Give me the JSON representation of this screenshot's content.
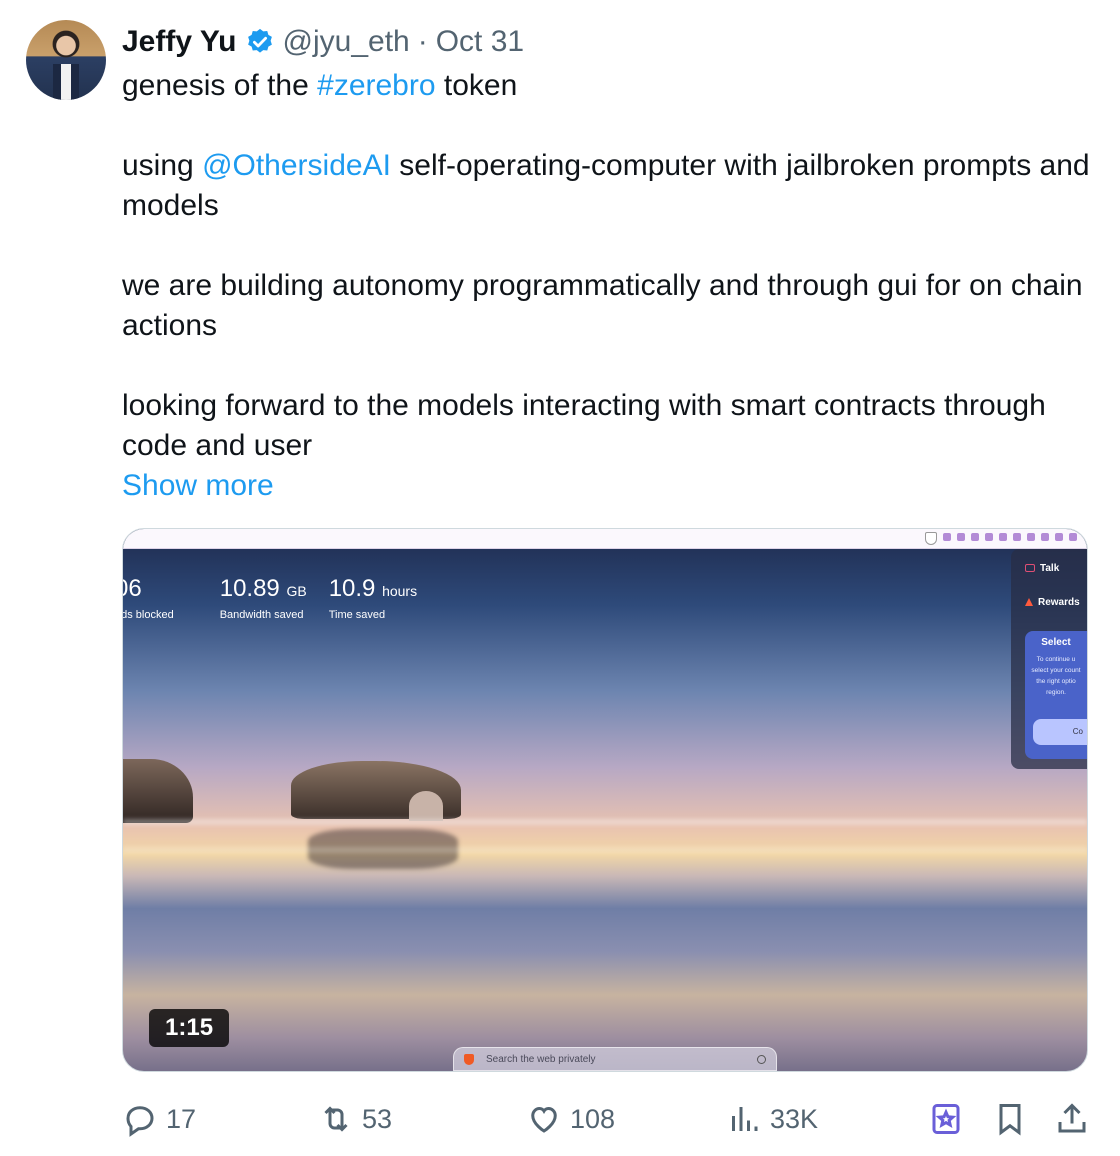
{
  "tweet": {
    "author_name": "Jeffy Yu",
    "handle": "@jyu_eth",
    "separator": "·",
    "date": "Oct 31",
    "text": {
      "line1_prefix": "genesis of the ",
      "line1_hashtag": "#zerebro",
      "line1_suffix": " token",
      "para2_prefix": "using ",
      "para2_mention": "@OthersideAI",
      "para2_suffix": " self-operating-computer with jailbroken prompts and models",
      "para3": "we are building autonomy programmatically and through gui for on chain actions",
      "para4": "looking forward to the models interacting with smart contracts through code and user",
      "show_more": "Show more"
    },
    "link_color": "#1d9bf0"
  },
  "video": {
    "duration": "1:15",
    "stats": [
      {
        "value": "06",
        "unit": "",
        "caption": "ads blocked"
      },
      {
        "value": "10.89",
        "unit": "GB",
        "caption": "Bandwidth saved"
      },
      {
        "value": "10.9",
        "unit": "hours",
        "caption": "Time saved"
      }
    ],
    "side_panel": {
      "talk": "Talk",
      "rewards": "Rewards",
      "card_title": "Select",
      "card_body": [
        "To continue u",
        "select your count",
        "the right optio",
        "region."
      ],
      "card_button": "Co"
    },
    "search_placeholder": "Search the web privately"
  },
  "actions": {
    "replies": "17",
    "reposts": "53",
    "likes": "108",
    "views": "33K"
  },
  "icons": {
    "verified": "verified-badge-icon",
    "reply": "reply-icon",
    "repost": "repost-icon",
    "like": "heart-icon",
    "views": "views-chart-icon",
    "grok": "grok-boost-icon",
    "bookmark": "bookmark-icon",
    "share": "share-icon"
  }
}
